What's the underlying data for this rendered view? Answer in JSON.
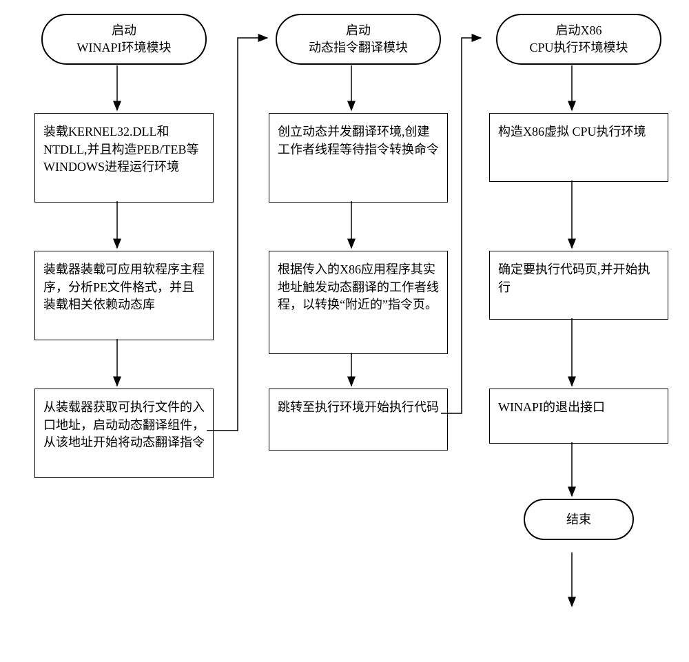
{
  "chart_data": {
    "type": "flowchart",
    "columns": [
      {
        "header": "启动\nWINAPI环境模块",
        "steps": [
          "装载KERNEL32.DLL和NTDLL,并且构造PEB/TEB等WINDOWS进程运行环境",
          "装载器装载可应用软程序主程序，分析PE文件格式，并且装载相关依赖动态库",
          "从装载器获取可执行文件的入口地址，启动动态翻译组件，从该地址开始将动态翻译指令"
        ]
      },
      {
        "header": "启动\n动态指令翻译模块",
        "steps": [
          "创立动态并发翻译环境,创建工作者线程等待指令转换命令",
          "根据传入的X86应用程序其实地址触发动态翻译的工作者线程，以转换“附近的”指令页。",
          "跳转至执行环境开始执行代码"
        ]
      },
      {
        "header": "启动X86\nCPU执行环境模块",
        "steps": [
          "构造X86虚拟 CPU执行环境",
          "确定要执行代码页,并开始执行",
          "WINAPI的退出接口"
        ],
        "end": "结束"
      }
    ]
  }
}
